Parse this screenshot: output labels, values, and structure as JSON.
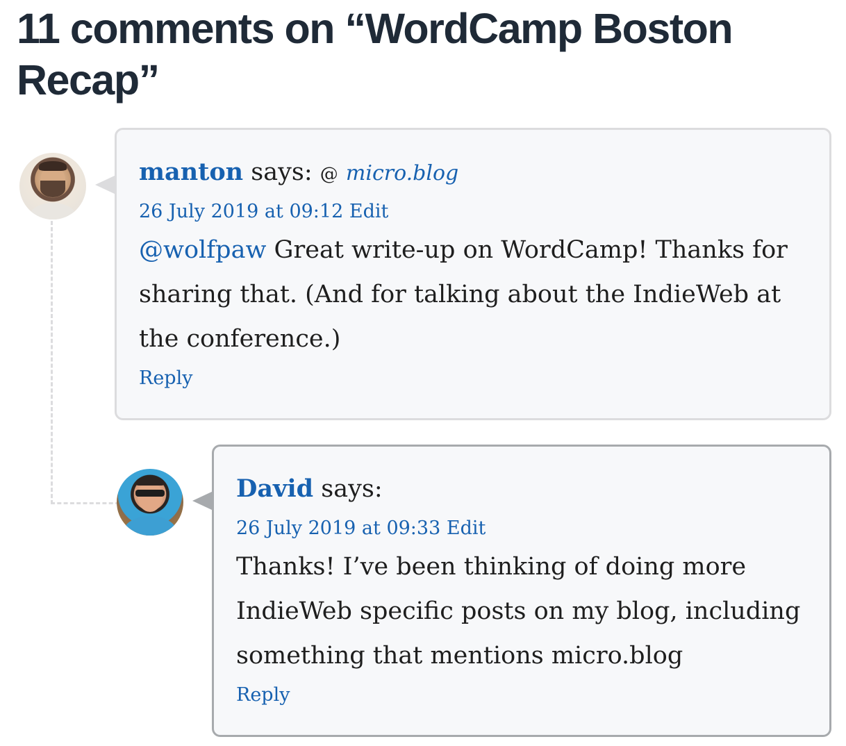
{
  "heading": {
    "line1": "11 comments on “WordCamp Boston",
    "line2": "Recap”"
  },
  "comments": [
    {
      "author": "manton",
      "says": "says:",
      "at_symbol": "@",
      "site": "micro.blog",
      "date": "26 July 2019 at 09:12",
      "edit": "Edit",
      "mention": "@wolfpaw",
      "text_line1": " Great write-up on WordCamp! Thanks for",
      "text_line2": "sharing that. (And for talking about the IndieWeb at",
      "text_line3": "the conference.)",
      "reply": "Reply",
      "avatar_icon": "avatar-manton"
    },
    {
      "author": "David",
      "says": "says:",
      "date": "26 July 2019 at 09:33",
      "edit": "Edit",
      "text_line1": "Thanks! I’ve been thinking of doing more",
      "text_line2": "IndieWeb specific posts on my blog, including",
      "text_line3": "something that mentions micro.blog",
      "reply": "Reply",
      "avatar_icon": "avatar-david"
    }
  ],
  "colors": {
    "link": "#1761b0",
    "heading": "#1f2a37",
    "card_bg": "#f7f8fa",
    "card1_border": "#dcdcde",
    "card2_border": "#a7aaad"
  }
}
